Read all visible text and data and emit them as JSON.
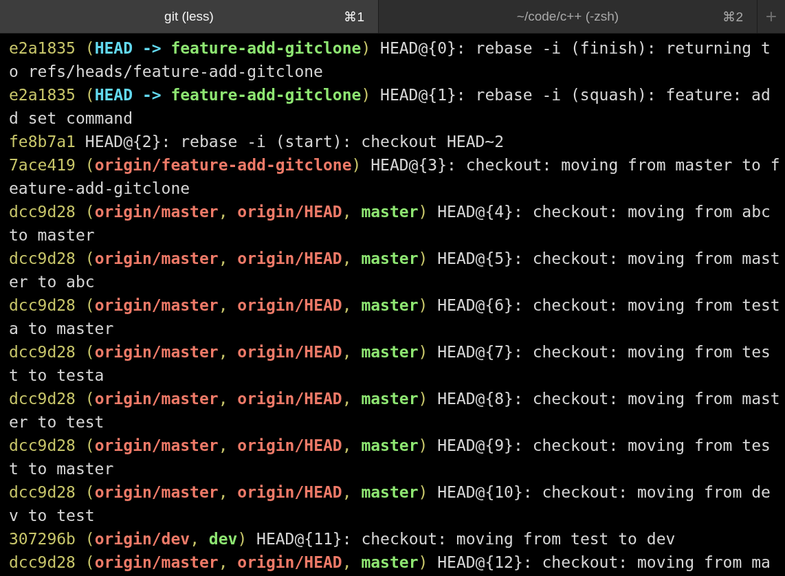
{
  "tabs": [
    {
      "label": "git (less)",
      "shortcut": "⌘1",
      "selected": true
    },
    {
      "label": "~/code/c++ (-zsh)",
      "shortcut": "⌘2",
      "selected": false
    }
  ],
  "new_tab": "+",
  "entries": [
    [
      {
        "kind": "hash",
        "text": "e2a1835"
      },
      {
        "kind": "punct",
        "text": " ("
      },
      {
        "kind": "head",
        "text": "HEAD -> "
      },
      {
        "kind": "local",
        "text": "feature-add-gitclone"
      },
      {
        "kind": "punct",
        "text": ")"
      },
      {
        "kind": "text",
        "text": " HEAD@{0}: rebase -i (finish): returning to refs/heads/feature-add-gitclone"
      }
    ],
    [
      {
        "kind": "hash",
        "text": "e2a1835"
      },
      {
        "kind": "punct",
        "text": " ("
      },
      {
        "kind": "head",
        "text": "HEAD -> "
      },
      {
        "kind": "local",
        "text": "feature-add-gitclone"
      },
      {
        "kind": "punct",
        "text": ")"
      },
      {
        "kind": "text",
        "text": " HEAD@{1}: rebase -i (squash): feature: add set command"
      }
    ],
    [
      {
        "kind": "hash",
        "text": "fe8b7a1"
      },
      {
        "kind": "text",
        "text": " HEAD@{2}: rebase -i (start): checkout HEAD~2"
      }
    ],
    [
      {
        "kind": "hash",
        "text": "7ace419"
      },
      {
        "kind": "punct",
        "text": " ("
      },
      {
        "kind": "remote",
        "text": "origin/feature-add-gitclone"
      },
      {
        "kind": "punct",
        "text": ")"
      },
      {
        "kind": "text",
        "text": " HEAD@{3}: checkout: moving from master to feature-add-gitclone"
      }
    ],
    [
      {
        "kind": "hash",
        "text": "dcc9d28"
      },
      {
        "kind": "punct",
        "text": " ("
      },
      {
        "kind": "remote",
        "text": "origin/master"
      },
      {
        "kind": "punct",
        "text": ", "
      },
      {
        "kind": "remote",
        "text": "origin/HEAD"
      },
      {
        "kind": "punct",
        "text": ", "
      },
      {
        "kind": "local",
        "text": "master"
      },
      {
        "kind": "punct",
        "text": ")"
      },
      {
        "kind": "text",
        "text": " HEAD@{4}: checkout: moving from abc to master"
      }
    ],
    [
      {
        "kind": "hash",
        "text": "dcc9d28"
      },
      {
        "kind": "punct",
        "text": " ("
      },
      {
        "kind": "remote",
        "text": "origin/master"
      },
      {
        "kind": "punct",
        "text": ", "
      },
      {
        "kind": "remote",
        "text": "origin/HEAD"
      },
      {
        "kind": "punct",
        "text": ", "
      },
      {
        "kind": "local",
        "text": "master"
      },
      {
        "kind": "punct",
        "text": ")"
      },
      {
        "kind": "text",
        "text": " HEAD@{5}: checkout: moving from master to abc"
      }
    ],
    [
      {
        "kind": "hash",
        "text": "dcc9d28"
      },
      {
        "kind": "punct",
        "text": " ("
      },
      {
        "kind": "remote",
        "text": "origin/master"
      },
      {
        "kind": "punct",
        "text": ", "
      },
      {
        "kind": "remote",
        "text": "origin/HEAD"
      },
      {
        "kind": "punct",
        "text": ", "
      },
      {
        "kind": "local",
        "text": "master"
      },
      {
        "kind": "punct",
        "text": ")"
      },
      {
        "kind": "text",
        "text": " HEAD@{6}: checkout: moving from testa to master"
      }
    ],
    [
      {
        "kind": "hash",
        "text": "dcc9d28"
      },
      {
        "kind": "punct",
        "text": " ("
      },
      {
        "kind": "remote",
        "text": "origin/master"
      },
      {
        "kind": "punct",
        "text": ", "
      },
      {
        "kind": "remote",
        "text": "origin/HEAD"
      },
      {
        "kind": "punct",
        "text": ", "
      },
      {
        "kind": "local",
        "text": "master"
      },
      {
        "kind": "punct",
        "text": ")"
      },
      {
        "kind": "text",
        "text": " HEAD@{7}: checkout: moving from test to testa"
      }
    ],
    [
      {
        "kind": "hash",
        "text": "dcc9d28"
      },
      {
        "kind": "punct",
        "text": " ("
      },
      {
        "kind": "remote",
        "text": "origin/master"
      },
      {
        "kind": "punct",
        "text": ", "
      },
      {
        "kind": "remote",
        "text": "origin/HEAD"
      },
      {
        "kind": "punct",
        "text": ", "
      },
      {
        "kind": "local",
        "text": "master"
      },
      {
        "kind": "punct",
        "text": ")"
      },
      {
        "kind": "text",
        "text": " HEAD@{8}: checkout: moving from master to test"
      }
    ],
    [
      {
        "kind": "hash",
        "text": "dcc9d28"
      },
      {
        "kind": "punct",
        "text": " ("
      },
      {
        "kind": "remote",
        "text": "origin/master"
      },
      {
        "kind": "punct",
        "text": ", "
      },
      {
        "kind": "remote",
        "text": "origin/HEAD"
      },
      {
        "kind": "punct",
        "text": ", "
      },
      {
        "kind": "local",
        "text": "master"
      },
      {
        "kind": "punct",
        "text": ")"
      },
      {
        "kind": "text",
        "text": " HEAD@{9}: checkout: moving from test to master"
      }
    ],
    [
      {
        "kind": "hash",
        "text": "dcc9d28"
      },
      {
        "kind": "punct",
        "text": " ("
      },
      {
        "kind": "remote",
        "text": "origin/master"
      },
      {
        "kind": "punct",
        "text": ", "
      },
      {
        "kind": "remote",
        "text": "origin/HEAD"
      },
      {
        "kind": "punct",
        "text": ", "
      },
      {
        "kind": "local",
        "text": "master"
      },
      {
        "kind": "punct",
        "text": ")"
      },
      {
        "kind": "text",
        "text": " HEAD@{10}: checkout: moving from dev to test"
      }
    ],
    [
      {
        "kind": "hash",
        "text": "307296b"
      },
      {
        "kind": "punct",
        "text": " ("
      },
      {
        "kind": "remote",
        "text": "origin/dev"
      },
      {
        "kind": "punct",
        "text": ", "
      },
      {
        "kind": "local",
        "text": "dev"
      },
      {
        "kind": "punct",
        "text": ")"
      },
      {
        "kind": "text",
        "text": " HEAD@{11}: checkout: moving from test to dev"
      }
    ],
    [
      {
        "kind": "hash",
        "text": "dcc9d28"
      },
      {
        "kind": "punct",
        "text": " ("
      },
      {
        "kind": "remote",
        "text": "origin/master"
      },
      {
        "kind": "punct",
        "text": ", "
      },
      {
        "kind": "remote",
        "text": "origin/HEAD"
      },
      {
        "kind": "punct",
        "text": ", "
      },
      {
        "kind": "local",
        "text": "master"
      },
      {
        "kind": "punct",
        "text": ")"
      },
      {
        "kind": "text",
        "text": " HEAD@{12}: checkout: moving from ma"
      }
    ]
  ]
}
